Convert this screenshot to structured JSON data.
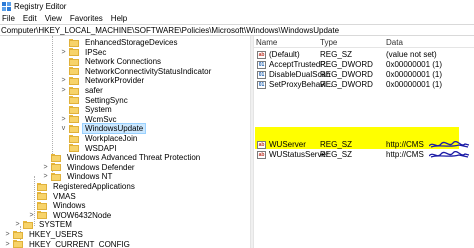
{
  "window": {
    "title": "Registry Editor"
  },
  "menu": [
    "File",
    "Edit",
    "View",
    "Favorites",
    "Help"
  ],
  "address": "Computer\\HKEY_LOCAL_MACHINE\\SOFTWARE\\Policies\\Microsoft\\Windows\\WindowsUpdate",
  "tree": [
    {
      "label": "EnhancedStorageDevices",
      "expander": ""
    },
    {
      "label": "IPSec",
      "expander": ">"
    },
    {
      "label": "Network Connections",
      "expander": ""
    },
    {
      "label": "NetworkConnectivityStatusIndicator",
      "expander": ""
    },
    {
      "label": "NetworkProvider",
      "expander": ">"
    },
    {
      "label": "safer",
      "expander": ">"
    },
    {
      "label": "SettingSync",
      "expander": ""
    },
    {
      "label": "System",
      "expander": ""
    },
    {
      "label": "WcmSvc",
      "expander": ">"
    },
    {
      "label": "WindowsUpdate",
      "expander": "v",
      "selected": true
    },
    {
      "label": "WorkplaceJoin",
      "expander": ""
    },
    {
      "label": "WSDAPI",
      "expander": ""
    },
    {
      "label": "Windows Advanced Threat Protection",
      "expander": ""
    },
    {
      "label": "Windows Defender",
      "expander": ">"
    },
    {
      "label": "Windows NT",
      "expander": ">"
    },
    {
      "label": "RegisteredApplications",
      "expander": ""
    },
    {
      "label": "VMAS",
      "expander": ""
    },
    {
      "label": "Windows",
      "expander": ""
    },
    {
      "label": "WOW6432Node",
      "expander": ">"
    },
    {
      "label": "SYSTEM",
      "expander": ">"
    },
    {
      "label": "HKEY_USERS",
      "expander": ">"
    },
    {
      "label": "HKEY_CURRENT_CONFIG",
      "expander": ">"
    }
  ],
  "values_header": {
    "name": "Name",
    "type": "Type",
    "data": "Data"
  },
  "values": [
    {
      "name": "(Default)",
      "type": "REG_SZ",
      "data": "(value not set)",
      "icon": "string-value-icon",
      "glyph": "ab"
    },
    {
      "name": "AcceptTrustedP...",
      "type": "REG_DWORD",
      "data": "0x00000001 (1)",
      "icon": "binary-value-icon",
      "glyph": "01"
    },
    {
      "name": "DisableDualScan",
      "type": "REG_DWORD",
      "data": "0x00000001 (1)",
      "icon": "binary-value-icon",
      "glyph": "01"
    },
    {
      "name": "SetProxyBehavi...",
      "type": "REG_DWORD",
      "data": "0x00000001 (1)",
      "icon": "binary-value-icon",
      "glyph": "01"
    },
    {
      "name": "WUServer",
      "type": "REG_SZ",
      "data": "http://CMS",
      "icon": "string-value-icon",
      "glyph": "ab"
    },
    {
      "name": "WUStatusServer",
      "type": "REG_SZ",
      "data": "http://CMS",
      "icon": "string-value-icon",
      "glyph": "ab"
    }
  ],
  "colors": {
    "highlight": "#ffff00",
    "selection": "#cce8ff",
    "folder": "#f7d36a",
    "scribble": "#1a1aa6"
  }
}
